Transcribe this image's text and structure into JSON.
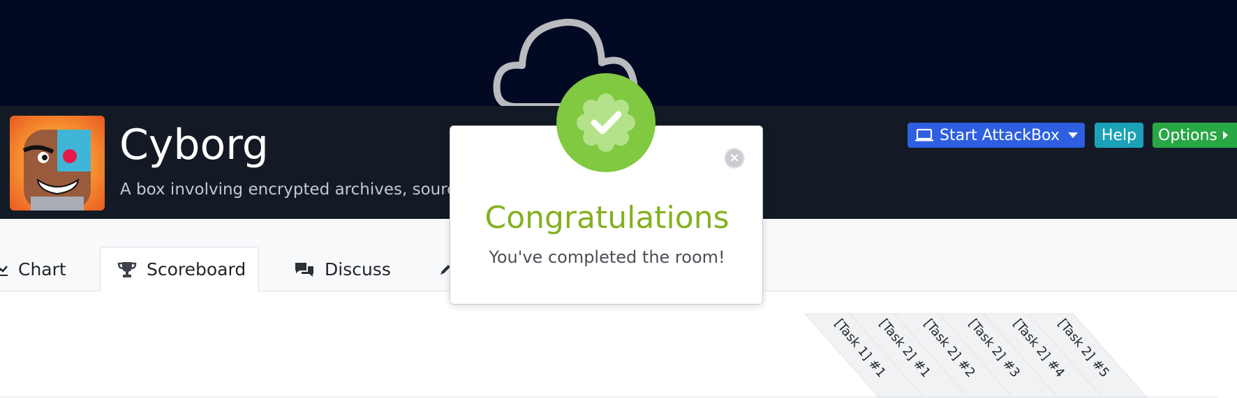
{
  "room": {
    "title": "Cyborg",
    "description": "A box involving encrypted archives, sourc"
  },
  "header_buttons": {
    "attackbox_label": "Start AttackBox",
    "help_label": "Help",
    "options_label": "Options"
  },
  "tabs": [
    {
      "label": "Chart",
      "icon": "chart-icon"
    },
    {
      "label": "Scoreboard",
      "icon": "trophy-icon",
      "active": true
    },
    {
      "label": "Discuss",
      "icon": "comments-icon"
    }
  ],
  "scoreboard": {
    "task_headers": [
      "[Task 1] #1",
      "[Task 2] #1",
      "[Task 2] #2",
      "[Task 2] #3",
      "[Task 2] #4",
      "[Task 2] #5"
    ]
  },
  "modal": {
    "title": "Congratulations",
    "subtitle": "You've completed the room!",
    "close_symbol": "×"
  },
  "colors": {
    "banner": "#020923",
    "header": "#131a26",
    "attackbox": "#2e5fe0",
    "help": "#1ba2b8",
    "options": "#28a745",
    "success": "#80c940",
    "congrats_text": "#84b01f"
  }
}
